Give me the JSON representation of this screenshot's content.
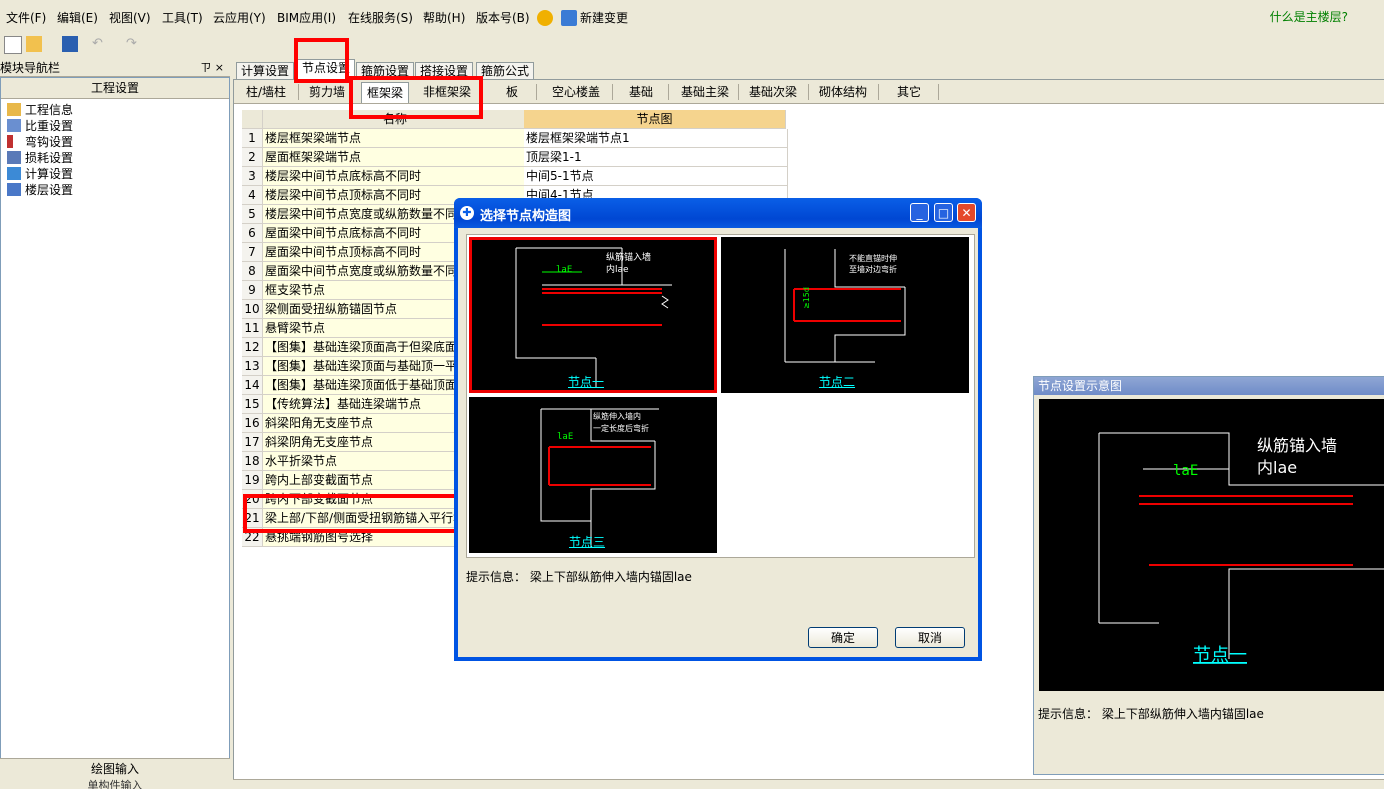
{
  "menu": {
    "items": [
      "文件(F)",
      "编辑(E)",
      "视图(V)",
      "工具(T)",
      "云应用(Y)",
      "BIM应用(I)",
      "在线服务(S)",
      "帮助(H)",
      "版本号(B)",
      "新建变更"
    ],
    "help_link": "什么是主楼层?"
  },
  "nav": {
    "title": "模块导航栏",
    "pin": "ㄗ ×",
    "header": "工程设置",
    "items": [
      "工程信息",
      "比重设置",
      "弯钩设置",
      "损耗设置",
      "计算设置",
      "楼层设置"
    ],
    "bottom1": "绘图输入",
    "bottom2": "单构件输入"
  },
  "tabs": [
    "计算设置",
    "节点设置",
    "箍筋设置",
    "搭接设置",
    "箍筋公式"
  ],
  "subtabs": [
    "柱/墙柱",
    "剪力墙",
    "框架梁",
    "非框架梁",
    "板",
    "空心楼盖",
    "基础",
    "基础主梁",
    "基础次梁",
    "砌体结构",
    "其它"
  ],
  "grid": {
    "headers": [
      "",
      "名称",
      "节点图"
    ],
    "rows": [
      {
        "num": "1",
        "name": "楼层框架梁端节点",
        "img": "楼层框架梁端节点1"
      },
      {
        "num": "2",
        "name": "屋面框架梁端节点",
        "img": "顶层梁1-1"
      },
      {
        "num": "3",
        "name": "楼层梁中间节点底标高不同时",
        "img": "中间5-1节点"
      },
      {
        "num": "4",
        "name": "楼层梁中间节点顶标高不同时",
        "img": "中间4-1节点"
      },
      {
        "num": "5",
        "name": "楼层梁中间节点宽度或纵筋数量不同时",
        "img": ""
      },
      {
        "num": "6",
        "name": "屋面梁中间节点底标高不同时",
        "img": ""
      },
      {
        "num": "7",
        "name": "屋面梁中间节点顶标高不同时",
        "img": ""
      },
      {
        "num": "8",
        "name": "屋面梁中间节点宽度或纵筋数量不同时",
        "img": ""
      },
      {
        "num": "9",
        "name": "框支梁节点",
        "img": ""
      },
      {
        "num": "10",
        "name": "梁侧面受扭纵筋锚固节点",
        "img": ""
      },
      {
        "num": "11",
        "name": "悬臂梁节点",
        "img": ""
      },
      {
        "num": "12",
        "name": "【图集】基础连梁顶面高于但梁底面",
        "img": ""
      },
      {
        "num": "13",
        "name": "【图集】基础连梁顶面与基础顶一平",
        "img": ""
      },
      {
        "num": "14",
        "name": "【图集】基础连梁顶面低于基础顶面",
        "img": ""
      },
      {
        "num": "15",
        "name": "【传统算法】基础连梁端节点",
        "img": ""
      },
      {
        "num": "16",
        "name": "斜梁阳角无支座节点",
        "img": ""
      },
      {
        "num": "17",
        "name": "斜梁阴角无支座节点",
        "img": ""
      },
      {
        "num": "18",
        "name": "水平折梁节点",
        "img": ""
      },
      {
        "num": "19",
        "name": "跨内上部变截面节点",
        "img": ""
      },
      {
        "num": "20",
        "name": "跨内下部变截面节点",
        "img": ""
      },
      {
        "num": "21",
        "name": "梁上部/下部/侧面受扭钢筋锚入平行墙内",
        "img": ""
      },
      {
        "num": "22",
        "name": "悬挑端钢筋图号选择",
        "img": ""
      }
    ]
  },
  "dialog": {
    "title": "选择节点构造图",
    "thumbs": [
      {
        "label": "节点一",
        "text1": "纵筋锚入墙",
        "text2": "内lae",
        "dim": "laE"
      },
      {
        "label": "节点二",
        "text1": "不能直锚时伸",
        "text2": "至墙对边弯折",
        "dim": "≥15d"
      },
      {
        "label": "节点三",
        "text1": "纵筋伸入墙内",
        "text2": "一定长度后弯折",
        "dim": "laE"
      }
    ],
    "hint": "提示信息： 梁上下部纵筋伸入墙内锚固lae",
    "ok": "确定",
    "cancel": "取消"
  },
  "preview": {
    "title": "节点设置示意图",
    "text1": "纵筋锚入墙",
    "text2": "内lae",
    "dim": "laE",
    "label": "节点一",
    "hint": "提示信息： 梁上下部纵筋伸入墙内锚固lae"
  },
  "colors": {
    "highlight": "#ff0000",
    "rebar": "#e00000",
    "dim": "#00ff00",
    "label": "#00ffff"
  }
}
